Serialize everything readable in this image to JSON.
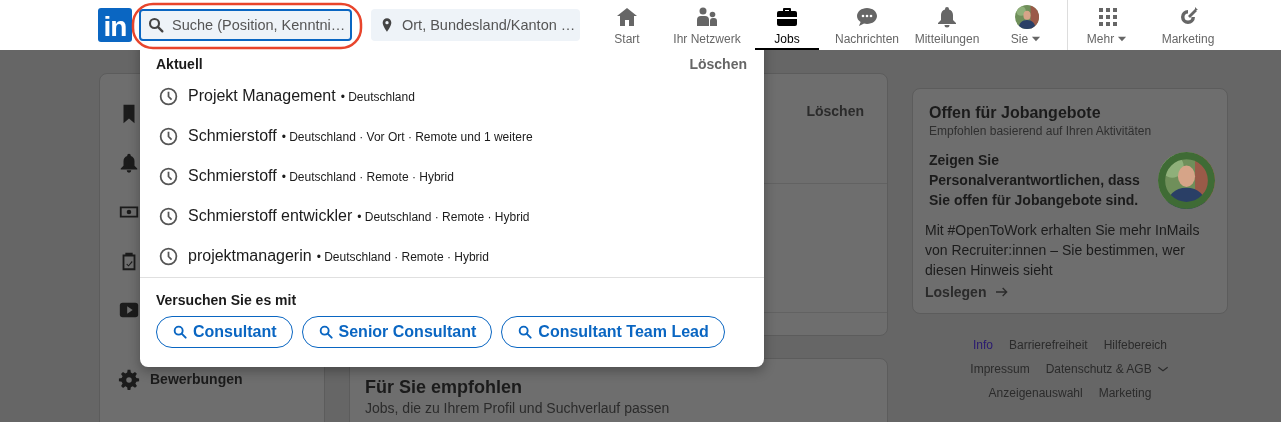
{
  "header": {
    "logo": "in",
    "search": {
      "placeholder": "Suche (Position, Kenntni…",
      "focused": true
    },
    "location": {
      "placeholder": "Ort, Bundesland/Kanton …"
    },
    "nav": [
      {
        "label": "Start",
        "caret": false,
        "selected": false
      },
      {
        "label": "Ihr Netzwerk",
        "caret": false,
        "selected": false
      },
      {
        "label": "Jobs",
        "caret": false,
        "selected": true
      },
      {
        "label": "Nachrichten",
        "caret": false,
        "selected": false
      },
      {
        "label": "Mitteilungen",
        "caret": false,
        "selected": false
      },
      {
        "label": "Sie",
        "caret": true,
        "selected": false
      }
    ],
    "nav_extra": [
      {
        "label": "Mehr",
        "caret": true,
        "selected": false
      },
      {
        "label": "Marketing",
        "caret": false,
        "selected": false
      }
    ]
  },
  "search_dropdown": {
    "heading": "Aktuell",
    "clear": "Löschen",
    "recent": [
      {
        "query": "Projekt Management",
        "details": "• Deutschland"
      },
      {
        "query": "Schmierstoff",
        "details": "• Deutschland · Vor Ort · Remote und 1 weitere"
      },
      {
        "query": "Schmierstoff",
        "details": "• Deutschland · Remote · Hybrid"
      },
      {
        "query": "Schmierstoff entwickler",
        "details": "• Deutschland · Remote · Hybrid"
      },
      {
        "query": "projektmanagerin",
        "details": "• Deutschland · Remote · Hybrid"
      }
    ],
    "suggest_heading": "Versuchen Sie es mit",
    "suggestions": [
      "Consultant",
      "Senior Consultant",
      "Consultant Team Lead"
    ]
  },
  "sidebar": {
    "settings_label": "Bewerbungen"
  },
  "main": {
    "searches_card": {
      "clear": "Löschen"
    },
    "recommended_card": {
      "title": "Für Sie empfohlen",
      "subtitle": "Jobs, die zu Ihrem Profil und Suchverlauf passen"
    }
  },
  "open_to_work": {
    "title": "Offen für Jobangebote",
    "subtitle": "Empfohlen basierend auf Ihren Aktivitäten",
    "headline": "Zeigen Sie Personalverantwortlichen, dass Sie offen für Jobangebote sind.",
    "body": "Mit #OpenToWork erhalten Sie mehr InMails von Recruiter:innen – Sie bestimmen, wer diesen Hinweis sieht",
    "link": "Loslegen"
  },
  "footer_links": [
    {
      "label": "Info",
      "visited": true,
      "caret": false
    },
    {
      "label": "Barrierefreiheit",
      "visited": false,
      "caret": false
    },
    {
      "label": "Hilfebereich",
      "visited": false,
      "caret": false
    },
    {
      "label": "Impressum",
      "visited": false,
      "caret": false
    },
    {
      "label": "Datenschutz & AGB",
      "visited": false,
      "caret": true
    },
    {
      "label": "Anzeigenauswahl",
      "visited": false,
      "caret": false
    },
    {
      "label": "Marketing",
      "visited": false,
      "caret": false
    }
  ]
}
